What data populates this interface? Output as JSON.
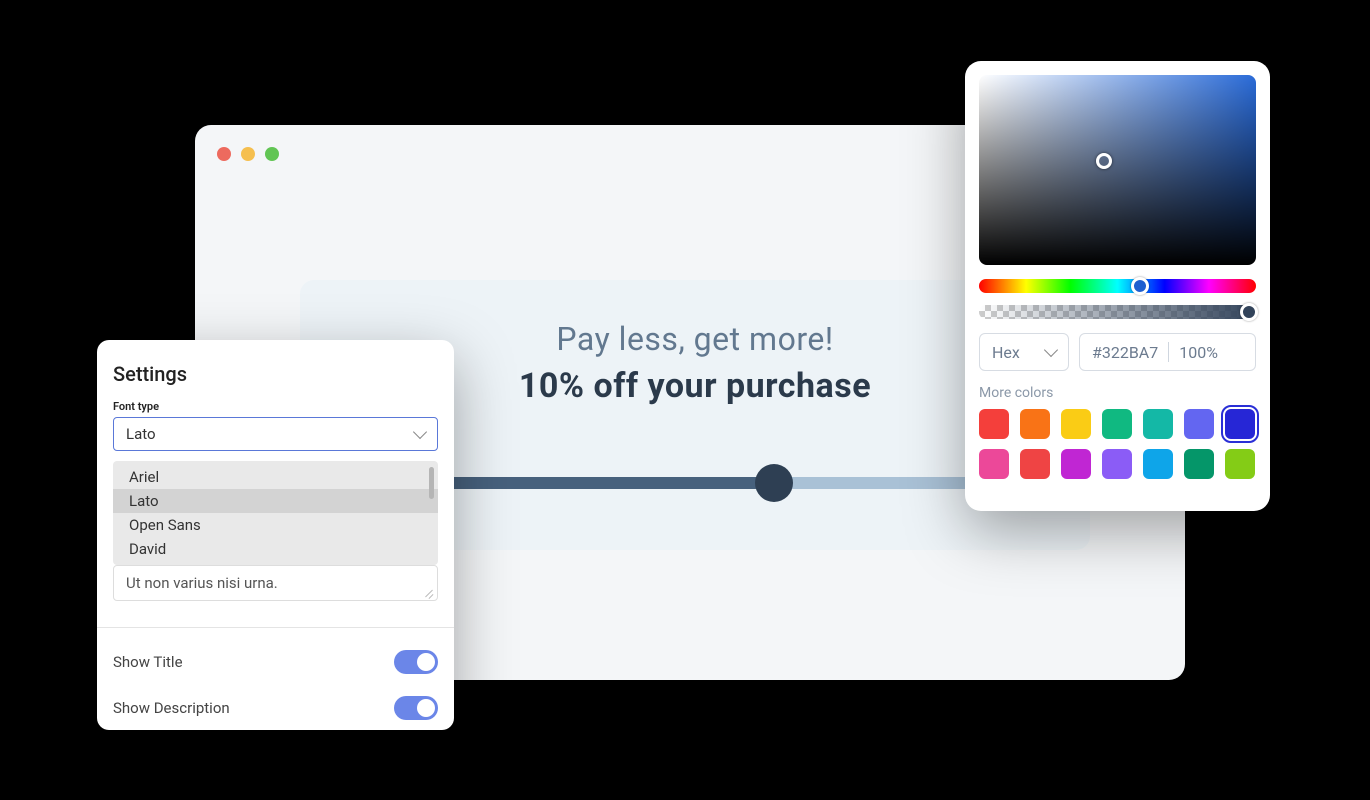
{
  "browser": {},
  "offer": {
    "title": "Pay less, get more!",
    "subtitle": "10% off your purchase",
    "slider_value_pct": 60
  },
  "settings": {
    "heading": "Settings",
    "font_type_label": "Font type",
    "font_type_value": "Lato",
    "font_options": [
      "Ariel",
      "Lato",
      "Open Sans",
      "David"
    ],
    "description_value": "Ut non varius nisi urna.",
    "toggles": [
      {
        "label": "Show Title",
        "on": true
      },
      {
        "label": "Show Description",
        "on": true
      }
    ]
  },
  "colorpicker": {
    "format": "Hex",
    "hex": "#322BA7",
    "opacity": "100%",
    "more_colors_label": "More colors",
    "swatches": [
      "#f43f3b",
      "#f97316",
      "#facc15",
      "#10b981",
      "#14b8a6",
      "#6366f1",
      "#2626d6",
      "#ec4899",
      "#ef4444",
      "#c026d3",
      "#8b5cf6",
      "#0ea5e9",
      "#059669",
      "#84cc16"
    ],
    "selected_swatch_index": 6
  }
}
